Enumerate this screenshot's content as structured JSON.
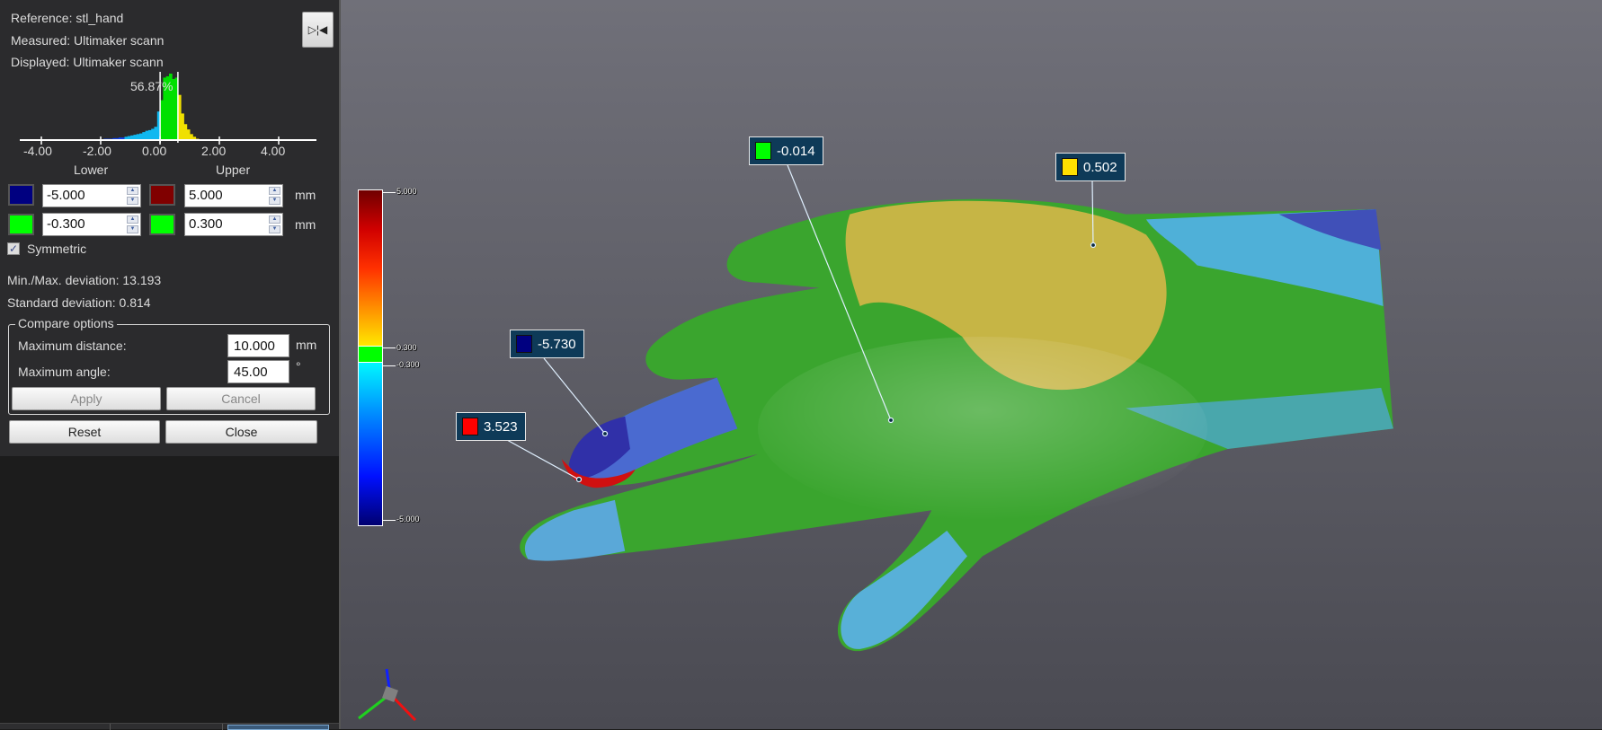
{
  "panel": {
    "reference": "Reference: stl_hand",
    "measured": "Measured: Ultimaker scann",
    "displayed": "Displayed: Ultimaker scann",
    "flip_icon": "flip-horizontal-icon",
    "flip_glyph": "▷¦◀",
    "histogram": {
      "percent_label": "56.87%",
      "ticks": [
        "-4.00",
        "-2.00",
        "0.00",
        "2.00",
        "4.00"
      ],
      "tick_values": [
        -4,
        -2,
        0,
        2,
        4
      ],
      "range": [
        -5.0,
        4.5
      ],
      "bin_width": 0.1,
      "bins_start": [
        -2.5,
        -2.4,
        -2.3,
        -2.2,
        -2.1,
        -2.0,
        -1.9,
        -1.8,
        -1.7,
        -1.6,
        -1.5,
        -1.4,
        -1.3,
        -1.2,
        -1.1,
        -1.0,
        -0.9,
        -0.8,
        -0.7,
        -0.6,
        -0.5,
        -0.4,
        -0.3,
        -0.2,
        -0.1,
        0.0,
        0.1,
        0.2,
        0.3,
        0.4,
        0.5,
        0.6,
        0.7,
        0.8,
        0.9
      ],
      "relative_counts": [
        1,
        1,
        1,
        2,
        2,
        2,
        3,
        3,
        4,
        4,
        5,
        6,
        7,
        8,
        9,
        10,
        12,
        14,
        15,
        17,
        20,
        43,
        60,
        94,
        96,
        100,
        92,
        94,
        68,
        40,
        24,
        16,
        9,
        5,
        2
      ],
      "threshold_lines": [
        -0.3,
        0.3
      ]
    },
    "lower_label": "Lower",
    "upper_label": "Upper",
    "lower_max": "-5.000",
    "upper_max": "5.000",
    "lower_tol": "-0.300",
    "upper_tol": "0.300",
    "unit": "mm",
    "colors": {
      "lower_max": "#000080",
      "upper_max": "#800000",
      "lower_tol": "#00ff00",
      "upper_tol": "#00ff00"
    },
    "symmetric_label": "Symmetric",
    "symmetric_checked": true,
    "check_glyph": "✓",
    "minmax": "Min./Max. deviation: 13.193",
    "stddev": "Standard deviation: 0.814",
    "compare": {
      "title": "Compare options",
      "max_distance_label": "Maximum distance:",
      "max_distance": "10.000",
      "max_distance_unit": "mm",
      "max_angle_label": "Maximum angle:",
      "max_angle": "45.00",
      "max_angle_unit": "°",
      "apply": "Apply",
      "cancel": "Cancel"
    },
    "reset": "Reset",
    "close": "Close"
  },
  "colorbar": {
    "labels": [
      "5.000",
      "0.300",
      "-0.300",
      "-5.000"
    ]
  },
  "callouts": [
    {
      "value": "-0.014",
      "color": "#00ff00"
    },
    {
      "value": "0.502",
      "color": "#ffe000"
    },
    {
      "value": "-5.730",
      "color": "#000080"
    },
    {
      "value": "3.523",
      "color": "#ff0000"
    }
  ]
}
